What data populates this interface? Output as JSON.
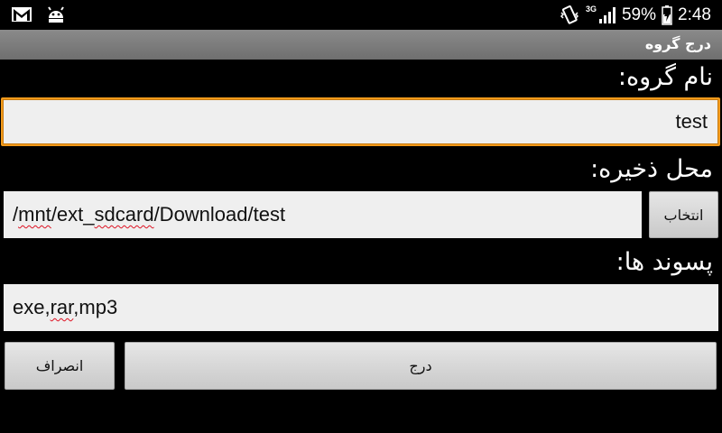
{
  "status_bar": {
    "left_icons": [
      "gmail-icon",
      "android-debug-icon"
    ],
    "network": "3G",
    "battery_percent": "59%",
    "time": "2:48"
  },
  "titlebar": {
    "title": "درج گروه"
  },
  "form": {
    "group_name_label": "نام گروه:",
    "group_name_value": "test",
    "save_location_label": "محل ذخیره:",
    "save_location_value": "/mnt/ext_sdcard/Download/test",
    "save_location_parts": [
      "/",
      "mnt",
      "/ext_",
      "sdcard",
      "/Download/test"
    ],
    "browse_button": "انتخاب",
    "extensions_label": "پسوند ها:",
    "extensions_value": "exe,rar,mp3",
    "extensions_parts": [
      "exe,",
      "rar",
      ",mp3"
    ]
  },
  "actions": {
    "cancel_button": "انصراف",
    "insert_button": "درج"
  },
  "colors": {
    "focus_border": "#f29a1b",
    "spellcheck": "#dd1122"
  }
}
